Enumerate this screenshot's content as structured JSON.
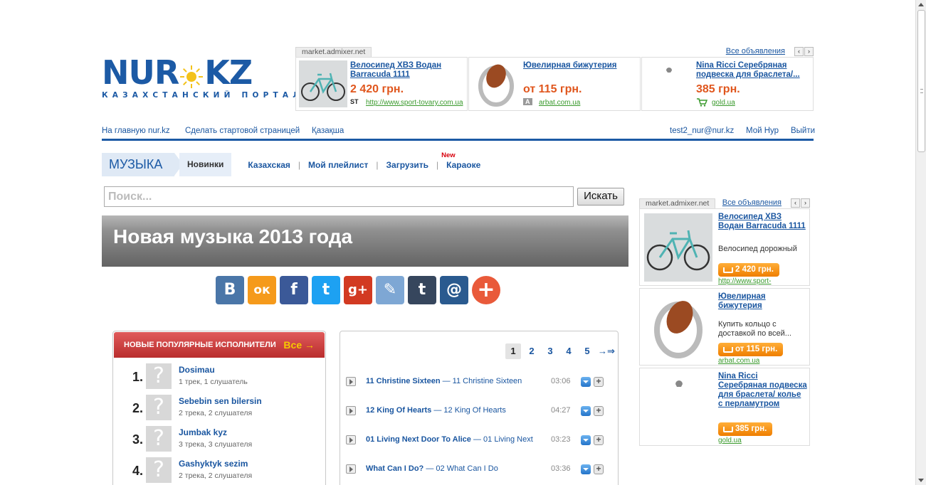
{
  "logo": {
    "left": "NUR",
    "right": "KZ",
    "tagline": "КАЗАХСТАНСКИЙ ПОРТАЛ"
  },
  "top_ad": {
    "source": "market.admixer.net",
    "all_ads": "Все объявления",
    "prev": "‹",
    "next": "›",
    "items": [
      {
        "title": "Велосипед ХВЗ Водан Barracuda 1111",
        "price": "2 420 грн.",
        "source_icon": "ST",
        "source": "http://www.sport-tovary.com.ua"
      },
      {
        "title": "Ювелирная бижутерия",
        "price": "от 115 грн.",
        "source_icon": "A",
        "source": "arbat.com.ua"
      },
      {
        "title": "Nina Ricci Серебряная подвеска для браслета/...",
        "price": "385 грн.",
        "source_icon": "cart",
        "source": "gold.ua"
      }
    ]
  },
  "topnav": {
    "home": "На главную nur.kz",
    "make_start": "Сделать стартовой страницей",
    "kazakh": "Қазақша",
    "email": "test2_nur@nur.kz",
    "my_nur": "Мой Нур",
    "logout": "Выйти"
  },
  "music": {
    "section": "МУЗЫКА",
    "tabs": [
      "Новинки",
      "Казахская",
      "Мой плейлист",
      "Загрузить",
      "Караоке"
    ],
    "new_badge": "New"
  },
  "search": {
    "placeholder": "Поиск...",
    "button": "Искать"
  },
  "banner": {
    "title": "Новая музыка 2013 года"
  },
  "share": [
    "В",
    "ок",
    "f",
    "t",
    "g+",
    "✎",
    "t",
    "@",
    "+"
  ],
  "popular": {
    "title": "НОВЫЕ ПОПУЛЯРНЫЕ ИСПОЛНИТЕЛИ",
    "all": "Все →",
    "avatar_placeholder": "?",
    "artists": [
      {
        "num": "1.",
        "name": "Dosimau",
        "meta": "1 трек, 1 слушатель"
      },
      {
        "num": "2.",
        "name": "Sebebin sen bilersin",
        "meta": "2 трека, 2 слушателя"
      },
      {
        "num": "3.",
        "name": "Jumbak kyz",
        "meta": "3 трека, 3 слушателя"
      },
      {
        "num": "4.",
        "name": "Gashyktyk sezim",
        "meta": "2 трека, 2 слушателя"
      }
    ]
  },
  "tracks": {
    "pages": [
      "1",
      "2",
      "3",
      "4",
      "5"
    ],
    "next": "→⇒",
    "items": [
      {
        "artist": "11 Christine Sixteen",
        "title": "— 11 Christine Sixteen",
        "dur": "03:06"
      },
      {
        "artist": "12 King Of Hearts",
        "title": "— 12 King Of Hearts",
        "dur": "04:27"
      },
      {
        "artist": "01 Living Next Door To Alice",
        "title": "— 01 Living Next",
        "dur": "03:23"
      },
      {
        "artist": "What Can I Do?",
        "title": "— 02 What Can I Do",
        "dur": "03:36"
      }
    ]
  },
  "right_ad": {
    "source": "market.admixer.net",
    "all_ads": "Все объявления",
    "prev": "‹",
    "next": "›",
    "items": [
      {
        "title": "Велосипед ХВЗ Водан Barracuda 1111",
        "desc": "Велосипед дорожный",
        "price": "2 420 грн.",
        "source": "http://www.sport-"
      },
      {
        "title": "Ювелирная бижутерия",
        "desc": "Купить кольцо с доставкой по всей...",
        "price": "от 115 грн.",
        "source": "arbat.com.ua"
      },
      {
        "title": "Nina Ricci Серебряная подвеска для браслета/ колье с перламутром",
        "desc": "",
        "price": "385 грн.",
        "source": "gold.ua"
      }
    ]
  },
  "colors": {
    "brand": "#1c5aa5",
    "price": "#e0561d",
    "accent_orange": "#ef7e00",
    "header_red": "#c23b3b"
  }
}
